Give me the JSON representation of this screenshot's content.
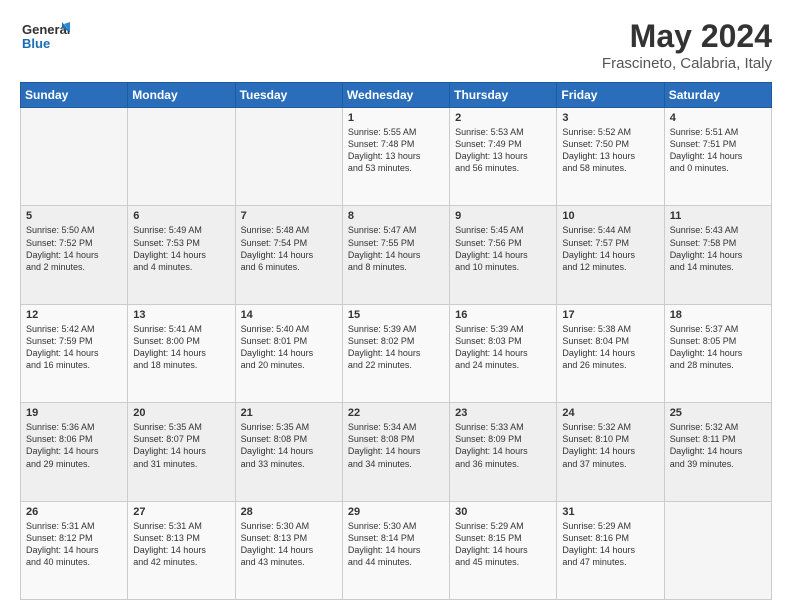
{
  "header": {
    "logo_line1": "General",
    "logo_line2": "Blue",
    "title": "May 2024",
    "subtitle": "Frascineto, Calabria, Italy"
  },
  "days_of_week": [
    "Sunday",
    "Monday",
    "Tuesday",
    "Wednesday",
    "Thursday",
    "Friday",
    "Saturday"
  ],
  "weeks": [
    [
      {
        "day": "",
        "content": ""
      },
      {
        "day": "",
        "content": ""
      },
      {
        "day": "",
        "content": ""
      },
      {
        "day": "1",
        "content": "Sunrise: 5:55 AM\nSunset: 7:48 PM\nDaylight: 13 hours\nand 53 minutes."
      },
      {
        "day": "2",
        "content": "Sunrise: 5:53 AM\nSunset: 7:49 PM\nDaylight: 13 hours\nand 56 minutes."
      },
      {
        "day": "3",
        "content": "Sunrise: 5:52 AM\nSunset: 7:50 PM\nDaylight: 13 hours\nand 58 minutes."
      },
      {
        "day": "4",
        "content": "Sunrise: 5:51 AM\nSunset: 7:51 PM\nDaylight: 14 hours\nand 0 minutes."
      }
    ],
    [
      {
        "day": "5",
        "content": "Sunrise: 5:50 AM\nSunset: 7:52 PM\nDaylight: 14 hours\nand 2 minutes."
      },
      {
        "day": "6",
        "content": "Sunrise: 5:49 AM\nSunset: 7:53 PM\nDaylight: 14 hours\nand 4 minutes."
      },
      {
        "day": "7",
        "content": "Sunrise: 5:48 AM\nSunset: 7:54 PM\nDaylight: 14 hours\nand 6 minutes."
      },
      {
        "day": "8",
        "content": "Sunrise: 5:47 AM\nSunset: 7:55 PM\nDaylight: 14 hours\nand 8 minutes."
      },
      {
        "day": "9",
        "content": "Sunrise: 5:45 AM\nSunset: 7:56 PM\nDaylight: 14 hours\nand 10 minutes."
      },
      {
        "day": "10",
        "content": "Sunrise: 5:44 AM\nSunset: 7:57 PM\nDaylight: 14 hours\nand 12 minutes."
      },
      {
        "day": "11",
        "content": "Sunrise: 5:43 AM\nSunset: 7:58 PM\nDaylight: 14 hours\nand 14 minutes."
      }
    ],
    [
      {
        "day": "12",
        "content": "Sunrise: 5:42 AM\nSunset: 7:59 PM\nDaylight: 14 hours\nand 16 minutes."
      },
      {
        "day": "13",
        "content": "Sunrise: 5:41 AM\nSunset: 8:00 PM\nDaylight: 14 hours\nand 18 minutes."
      },
      {
        "day": "14",
        "content": "Sunrise: 5:40 AM\nSunset: 8:01 PM\nDaylight: 14 hours\nand 20 minutes."
      },
      {
        "day": "15",
        "content": "Sunrise: 5:39 AM\nSunset: 8:02 PM\nDaylight: 14 hours\nand 22 minutes."
      },
      {
        "day": "16",
        "content": "Sunrise: 5:39 AM\nSunset: 8:03 PM\nDaylight: 14 hours\nand 24 minutes."
      },
      {
        "day": "17",
        "content": "Sunrise: 5:38 AM\nSunset: 8:04 PM\nDaylight: 14 hours\nand 26 minutes."
      },
      {
        "day": "18",
        "content": "Sunrise: 5:37 AM\nSunset: 8:05 PM\nDaylight: 14 hours\nand 28 minutes."
      }
    ],
    [
      {
        "day": "19",
        "content": "Sunrise: 5:36 AM\nSunset: 8:06 PM\nDaylight: 14 hours\nand 29 minutes."
      },
      {
        "day": "20",
        "content": "Sunrise: 5:35 AM\nSunset: 8:07 PM\nDaylight: 14 hours\nand 31 minutes."
      },
      {
        "day": "21",
        "content": "Sunrise: 5:35 AM\nSunset: 8:08 PM\nDaylight: 14 hours\nand 33 minutes."
      },
      {
        "day": "22",
        "content": "Sunrise: 5:34 AM\nSunset: 8:08 PM\nDaylight: 14 hours\nand 34 minutes."
      },
      {
        "day": "23",
        "content": "Sunrise: 5:33 AM\nSunset: 8:09 PM\nDaylight: 14 hours\nand 36 minutes."
      },
      {
        "day": "24",
        "content": "Sunrise: 5:32 AM\nSunset: 8:10 PM\nDaylight: 14 hours\nand 37 minutes."
      },
      {
        "day": "25",
        "content": "Sunrise: 5:32 AM\nSunset: 8:11 PM\nDaylight: 14 hours\nand 39 minutes."
      }
    ],
    [
      {
        "day": "26",
        "content": "Sunrise: 5:31 AM\nSunset: 8:12 PM\nDaylight: 14 hours\nand 40 minutes."
      },
      {
        "day": "27",
        "content": "Sunrise: 5:31 AM\nSunset: 8:13 PM\nDaylight: 14 hours\nand 42 minutes."
      },
      {
        "day": "28",
        "content": "Sunrise: 5:30 AM\nSunset: 8:13 PM\nDaylight: 14 hours\nand 43 minutes."
      },
      {
        "day": "29",
        "content": "Sunrise: 5:30 AM\nSunset: 8:14 PM\nDaylight: 14 hours\nand 44 minutes."
      },
      {
        "day": "30",
        "content": "Sunrise: 5:29 AM\nSunset: 8:15 PM\nDaylight: 14 hours\nand 45 minutes."
      },
      {
        "day": "31",
        "content": "Sunrise: 5:29 AM\nSunset: 8:16 PM\nDaylight: 14 hours\nand 47 minutes."
      },
      {
        "day": "",
        "content": ""
      }
    ]
  ]
}
